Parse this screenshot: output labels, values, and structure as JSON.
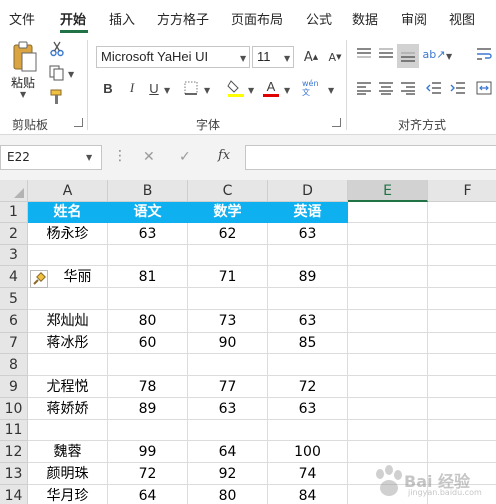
{
  "ribbon_tabs": [
    {
      "label": "文件",
      "active": false
    },
    {
      "label": "开始",
      "active": true
    },
    {
      "label": "插入",
      "active": false
    },
    {
      "label": "方方格子",
      "active": false
    },
    {
      "label": "页面布局",
      "active": false
    },
    {
      "label": "公式",
      "active": false
    },
    {
      "label": "数据",
      "active": false
    },
    {
      "label": "审阅",
      "active": false
    },
    {
      "label": "视图",
      "active": false
    }
  ],
  "ribbon": {
    "clipboard": {
      "paste_label": "粘贴",
      "group_label": "剪贴板"
    },
    "font": {
      "font_name": "Microsoft YaHei UI",
      "font_size": "11",
      "group_label": "字体",
      "bold": "B",
      "italic": "I",
      "underline": "U",
      "phonetic": "wén 文"
    },
    "alignment": {
      "group_label": "对齐方式"
    }
  },
  "formula_bar": {
    "name_box": "E22",
    "formula": ""
  },
  "columns": [
    "A",
    "B",
    "C",
    "D",
    "E",
    "F"
  ],
  "selected_column": "E",
  "rows": [
    {
      "num": "1",
      "cells": [
        "姓名",
        "语文",
        "数学",
        "英语"
      ]
    },
    {
      "num": "2",
      "cells": [
        "杨永珍",
        "63",
        "62",
        "63"
      ]
    },
    {
      "num": "3",
      "cells": [
        "",
        "",
        "",
        ""
      ]
    },
    {
      "num": "4",
      "cells": [
        "华丽",
        "81",
        "71",
        "89"
      ]
    },
    {
      "num": "5",
      "cells": [
        "",
        "",
        "",
        ""
      ]
    },
    {
      "num": "6",
      "cells": [
        "郑灿灿",
        "80",
        "73",
        "63"
      ]
    },
    {
      "num": "7",
      "cells": [
        "蒋冰彤",
        "60",
        "90",
        "85"
      ]
    },
    {
      "num": "8",
      "cells": [
        "",
        "",
        "",
        ""
      ]
    },
    {
      "num": "9",
      "cells": [
        "尤程悦",
        "78",
        "77",
        "72"
      ]
    },
    {
      "num": "10",
      "cells": [
        "蒋娇娇",
        "89",
        "63",
        "63"
      ]
    },
    {
      "num": "11",
      "cells": [
        "",
        "",
        "",
        ""
      ]
    },
    {
      "num": "12",
      "cells": [
        "魏蓉",
        "99",
        "64",
        "100"
      ]
    },
    {
      "num": "13",
      "cells": [
        "颜明珠",
        "72",
        "92",
        "74"
      ]
    },
    {
      "num": "14",
      "cells": [
        "华月珍",
        "64",
        "80",
        "84"
      ]
    }
  ],
  "colors": {
    "accent": "#217346",
    "header_fill": "#0fb0f0",
    "header_text": "#ffffff"
  },
  "watermark": {
    "text": "Bai 经验",
    "sub": "jingyan.baidu.com"
  }
}
